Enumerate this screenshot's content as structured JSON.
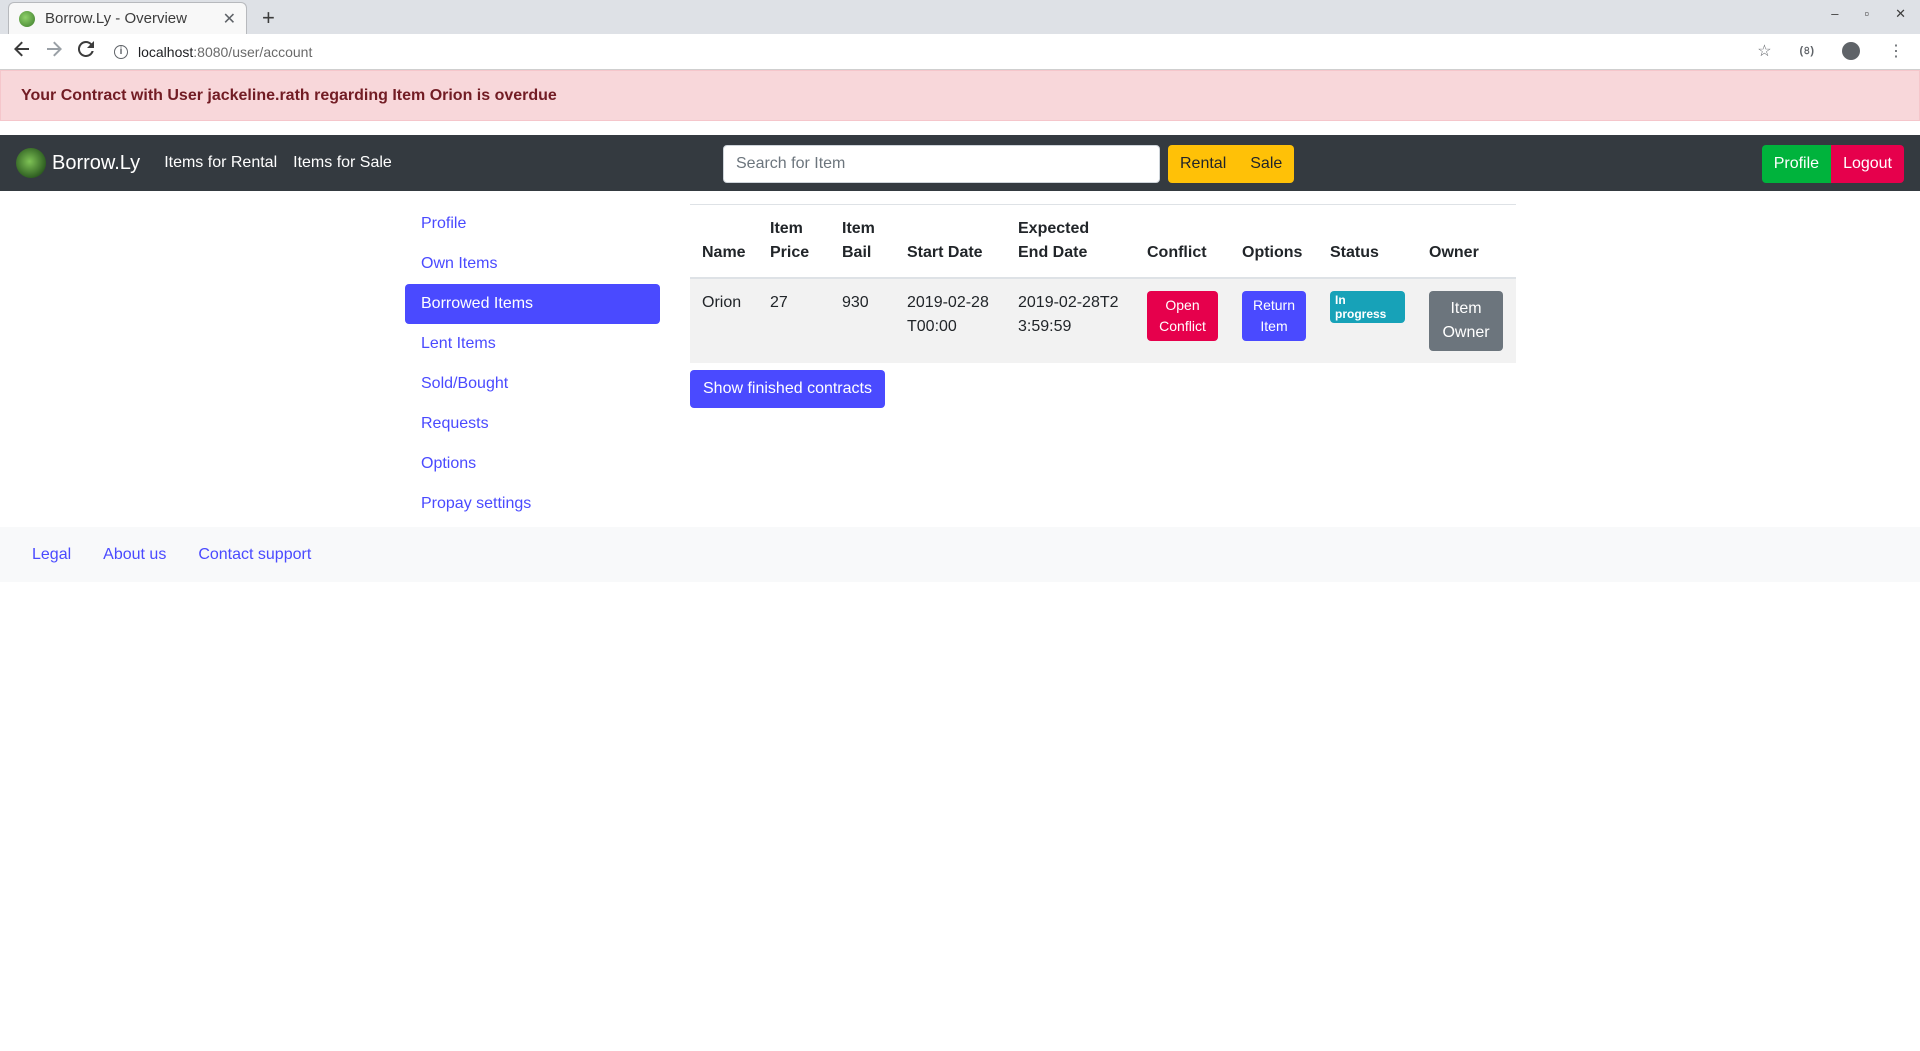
{
  "browser": {
    "tab_title": "Borrow.Ly - Overview",
    "tab_close": "✕",
    "new_tab": "+",
    "url_host": "localhost",
    "url_rest": ":8080/user/account",
    "window_controls": [
      "–",
      "▫",
      "✕"
    ],
    "ext_label": "(৪)"
  },
  "alert": {
    "message": "Your Contract with User jackeline.rath regarding Item Orion is overdue"
  },
  "navbar": {
    "brand": "Borrow.Ly",
    "links": [
      "Items for Rental",
      "Items for Sale"
    ],
    "search_placeholder": "Search for Item",
    "rental_label": "Rental",
    "sale_label": "Sale",
    "profile_label": "Profile",
    "logout_label": "Logout"
  },
  "sidebar": {
    "items": [
      {
        "label": "Profile",
        "active": false
      },
      {
        "label": "Own Items",
        "active": false
      },
      {
        "label": "Borrowed Items",
        "active": true
      },
      {
        "label": "Lent Items",
        "active": false
      },
      {
        "label": "Sold/Bought",
        "active": false
      },
      {
        "label": "Requests",
        "active": false
      },
      {
        "label": "Options",
        "active": false
      },
      {
        "label": "Propay settings",
        "active": false
      }
    ]
  },
  "table": {
    "headers": [
      "Name",
      "Item Price",
      "Item Bail",
      "Start Date",
      "Expected End Date",
      "Conflict",
      "Options",
      "Status",
      "Owner"
    ],
    "rows": [
      {
        "name": "Orion",
        "price": "27",
        "bail": "930",
        "start_date": "2019-02-28T00:00",
        "end_date": "2019-02-28T23:59:59",
        "conflict_label": "Open Conflict",
        "options_label": "Return Item",
        "status": "In progress",
        "owner_label": "Item Owner"
      }
    ]
  },
  "show_finished_label": "Show finished contracts",
  "footer": {
    "links": [
      "Legal",
      "About us",
      "Contact support"
    ]
  },
  "colors": {
    "primary": "#4a4aff",
    "danger": "#e6004c",
    "success": "#00b33c",
    "warning": "#ffc107",
    "navbar": "#343a40",
    "info": "#17a2b8"
  }
}
